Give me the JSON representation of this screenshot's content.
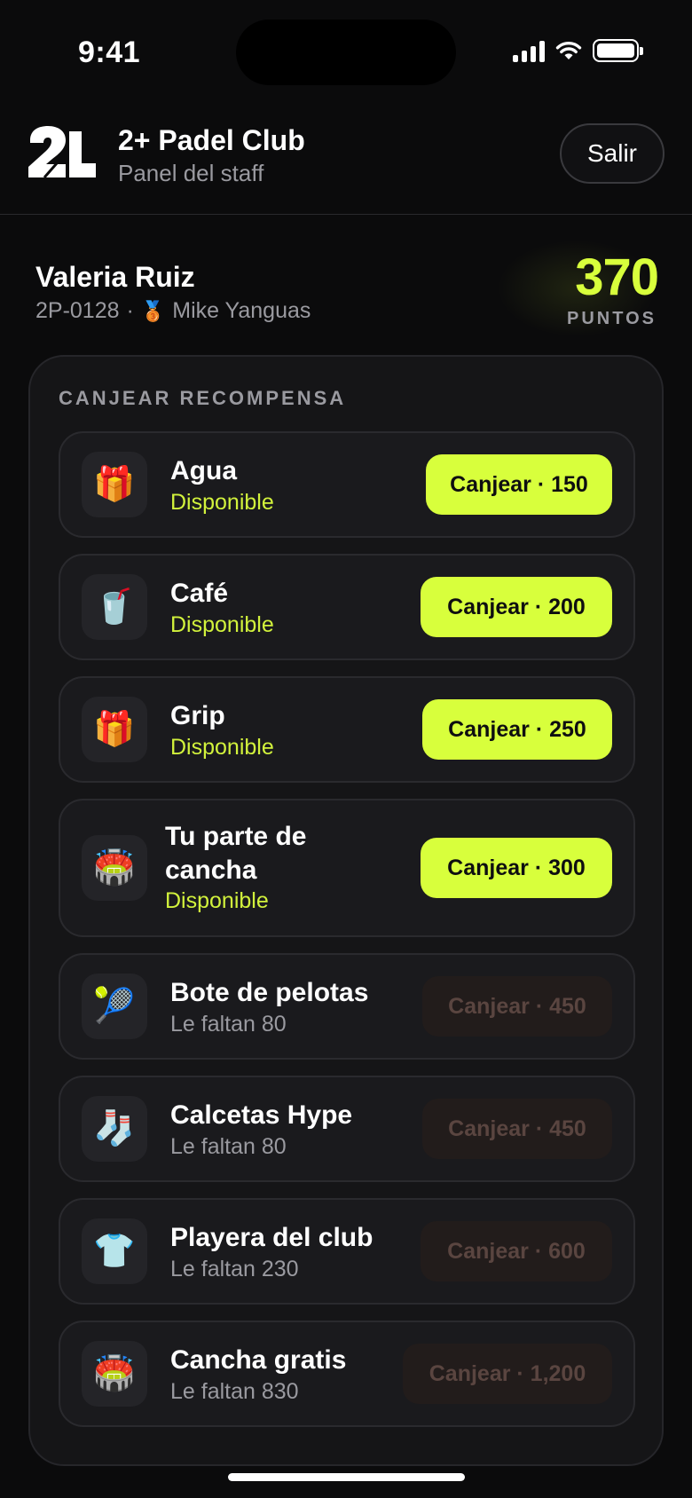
{
  "status_bar": {
    "time": "9:41"
  },
  "header": {
    "club_name": "2+ Padel Club",
    "subtitle": "Panel del staff",
    "logout_label": "Salir",
    "logo_text": "2+"
  },
  "member": {
    "name": "Valeria Ruiz",
    "id": "2P-0128",
    "separator": "·",
    "coach": "Mike Yanguas",
    "points": "370",
    "points_label": "PUNTOS"
  },
  "rewards": {
    "section_title": "CANJEAR RECOMPENSA",
    "items": [
      {
        "name": "Agua",
        "status": "Disponible",
        "button": "Canjear · 150",
        "available": true,
        "icon": "gift-icon",
        "glyph": "🎁"
      },
      {
        "name": "Café",
        "status": "Disponible",
        "button": "Canjear · 200",
        "available": true,
        "icon": "cup-icon",
        "glyph": "🥤"
      },
      {
        "name": "Grip",
        "status": "Disponible",
        "button": "Canjear · 250",
        "available": true,
        "icon": "gift-icon",
        "glyph": "🎁"
      },
      {
        "name": "Tu parte de cancha",
        "status": "Disponible",
        "button": "Canjear · 300",
        "available": true,
        "icon": "stadium-icon",
        "glyph": "🏟️"
      },
      {
        "name": "Bote de pelotas",
        "status": "Le faltan 80",
        "button": "Canjear · 450",
        "available": false,
        "icon": "tennis-icon",
        "glyph": "🎾"
      },
      {
        "name": "Calcetas Hype",
        "status": "Le faltan 80",
        "button": "Canjear · 450",
        "available": false,
        "icon": "socks-icon",
        "glyph": "🧦"
      },
      {
        "name": "Playera del club",
        "status": "Le faltan 230",
        "button": "Canjear · 600",
        "available": false,
        "icon": "tshirt-icon",
        "glyph": "👕"
      },
      {
        "name": "Cancha gratis",
        "status": "Le faltan 830",
        "button": "Canjear · 1,200",
        "available": false,
        "icon": "stadium-icon",
        "glyph": "🏟️"
      }
    ]
  },
  "colors": {
    "accent": "#d8ff3c",
    "background": "#0b0b0c",
    "card": "#151517"
  }
}
